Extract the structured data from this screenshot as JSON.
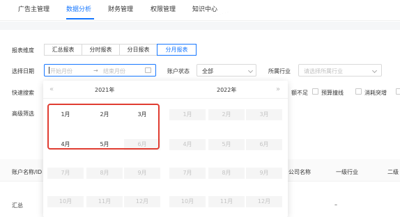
{
  "nav": {
    "items": [
      "广告主管理",
      "数据分析",
      "财务管理",
      "权限管理",
      "知识中心"
    ],
    "active_index": 1
  },
  "filters": {
    "report_dimension_label": "报表维度",
    "report_types": [
      "汇总报表",
      "分时报表",
      "分日报表",
      "分月报表"
    ],
    "active_report_type_index": 3,
    "date_label": "选择日期",
    "start_placeholder": "开始月份",
    "end_placeholder": "结束月份",
    "range_separator": "→",
    "account_status_label": "账户状态",
    "account_status_value": "全部",
    "industry_label": "所属行业",
    "industry_placeholder": "请选择所属行业",
    "quick_search_label": "快速搜索",
    "quick_checks": [
      "额不足",
      "预算撞线",
      "消耗突增"
    ],
    "advanced_label": "高级筛选"
  },
  "table": {
    "columns": [
      "账户名称/ID",
      "公司名称",
      "一级行业",
      "二级"
    ],
    "summary_row_label": "汇总",
    "summary_dash": "–"
  },
  "picker": {
    "left_year": "2021年",
    "right_year": "2022年",
    "prev_label": "«",
    "next_label": "»",
    "months": [
      "1月",
      "2月",
      "3月",
      "4月",
      "5月",
      "6月",
      "7月",
      "8月",
      "9月",
      "10月",
      "11月",
      "12月"
    ],
    "left_enabled_months": 5
  },
  "colors": {
    "primary": "#1677ff",
    "highlight_red": "#e03c31",
    "disabled_text": "#c4c4c4"
  }
}
